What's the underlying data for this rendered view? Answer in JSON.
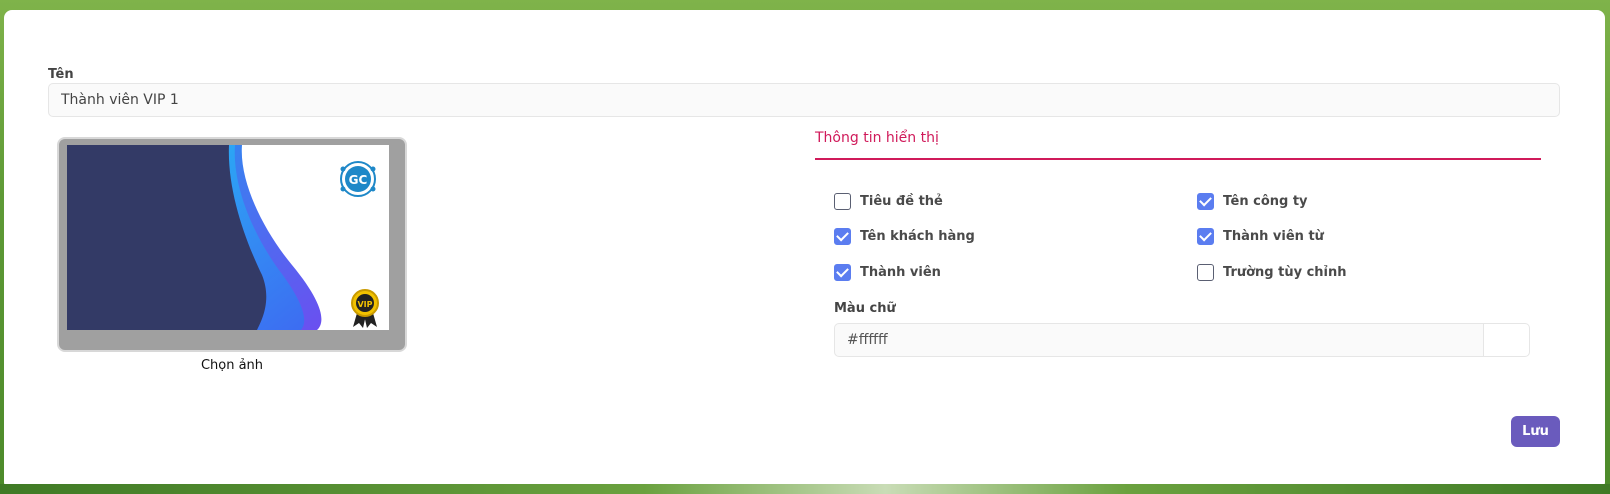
{
  "form": {
    "name_label": "Tên",
    "name_value": "Thành viên VIP 1",
    "choose_image_label": "Chọn ảnh",
    "card": {
      "logo_text": "GC",
      "badge_text": "VIP"
    },
    "display_section": {
      "title": "Thông tin hiển thị",
      "options": [
        {
          "label": "Tiêu đề thẻ",
          "checked": false
        },
        {
          "label": "Tên công ty",
          "checked": true
        },
        {
          "label": "Tên khách hàng",
          "checked": true
        },
        {
          "label": "Thành viên từ",
          "checked": true
        },
        {
          "label": "Thành viên",
          "checked": true
        },
        {
          "label": "Trường tùy chỉnh",
          "checked": false
        }
      ]
    },
    "text_color": {
      "label": "Màu chữ",
      "value": "#ffffff"
    },
    "save_label": "Lưu"
  },
  "colors": {
    "accent": "#d01a5a",
    "checkbox": "#5b7df0",
    "save_button": "#6a5bbd",
    "card_dark": "#333a66"
  }
}
